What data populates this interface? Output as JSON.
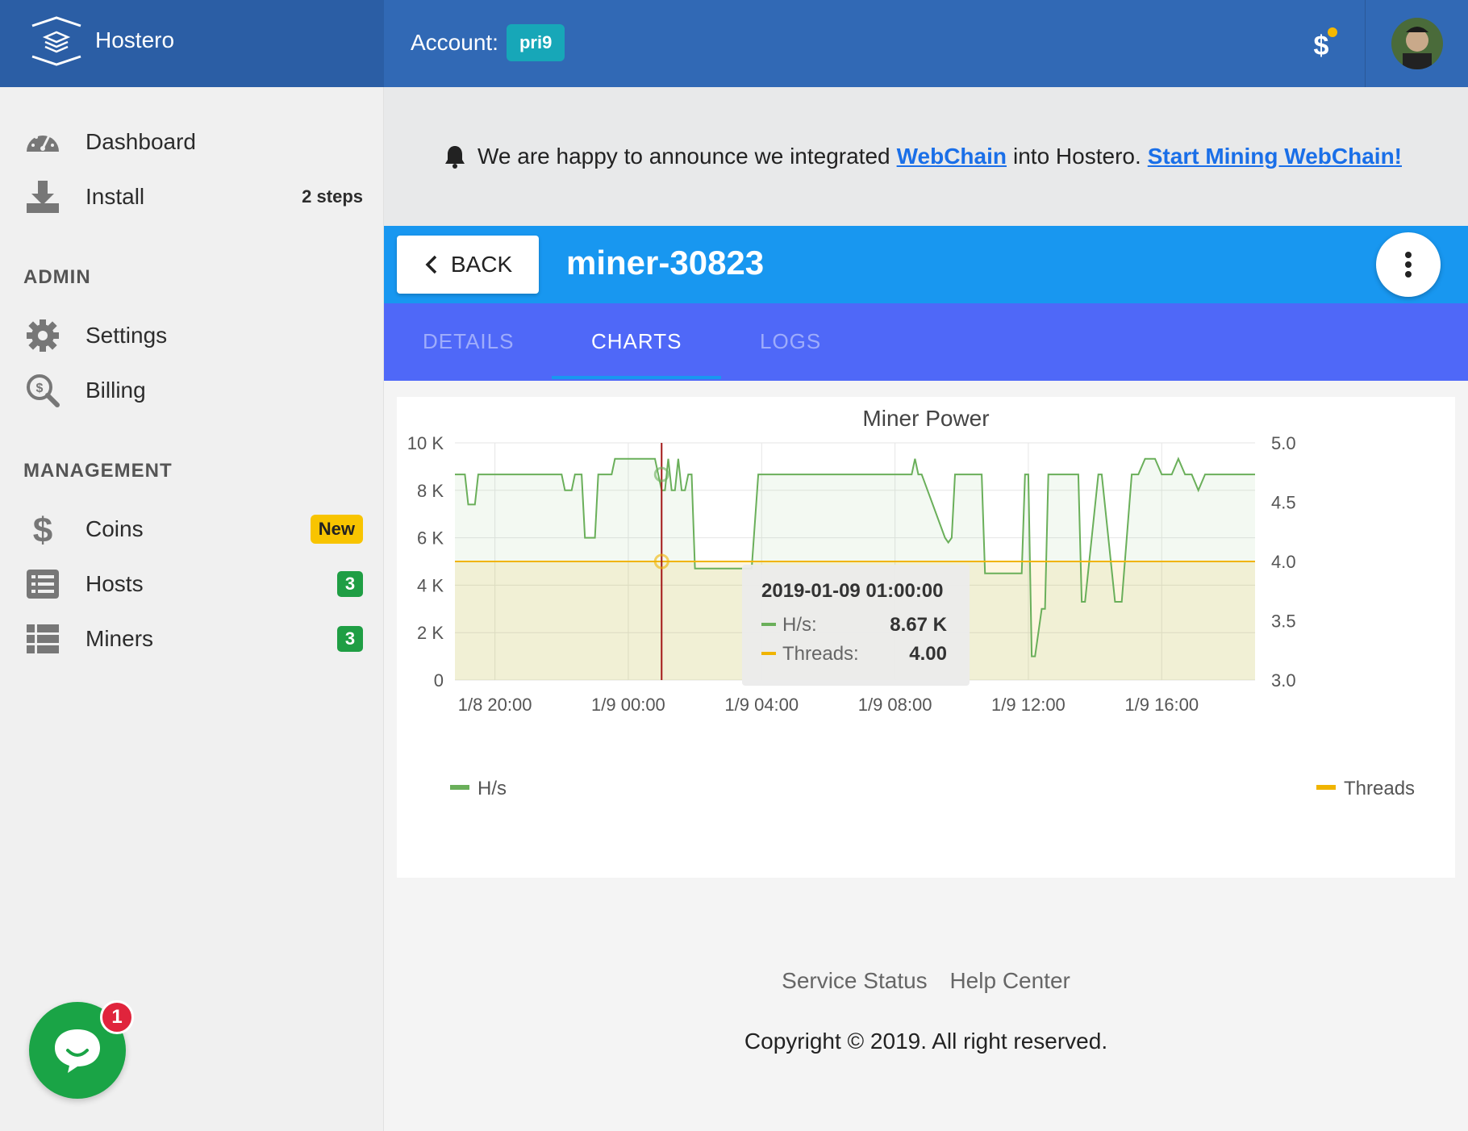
{
  "brand": {
    "name": "Hostero"
  },
  "header": {
    "account_label": "Account:",
    "account_value": "pri9"
  },
  "sidebar": {
    "items_top": [
      {
        "label": "Dashboard",
        "icon": "dashboard-icon"
      },
      {
        "label": "Install",
        "icon": "download-icon",
        "extra": "2 steps"
      }
    ],
    "admin_title": "ADMIN",
    "admin_items": [
      {
        "label": "Settings",
        "icon": "gear-icon"
      },
      {
        "label": "Billing",
        "icon": "billing-search-icon"
      }
    ],
    "management_title": "MANAGEMENT",
    "management_items": [
      {
        "label": "Coins",
        "icon": "dollar-icon",
        "badge": "New"
      },
      {
        "label": "Hosts",
        "icon": "list-icon",
        "badge": "3"
      },
      {
        "label": "Miners",
        "icon": "table-icon",
        "badge": "3"
      }
    ]
  },
  "chat": {
    "unread": "1"
  },
  "announcement": {
    "text_before": "We are happy to announce we integrated",
    "link1": "WebChain",
    "text_middle": "into Hostero.",
    "link2": "Start Mining WebChain!"
  },
  "miner": {
    "back_label": "BACK",
    "title": "miner-30823"
  },
  "tabs": [
    {
      "label": "DETAILS",
      "active": false
    },
    {
      "label": "CHARTS",
      "active": true
    },
    {
      "label": "LOGS",
      "active": false
    }
  ],
  "chart_data": {
    "type": "line",
    "title": "Miner Power",
    "x_ticks": [
      "1/8 20:00",
      "1/9 00:00",
      "1/9 04:00",
      "1/9 08:00",
      "1/9 12:00",
      "1/9 16:00"
    ],
    "y_left_ticks": [
      "10 K",
      "8 K",
      "6 K",
      "4 K",
      "2 K",
      "0"
    ],
    "y_right_ticks": [
      "5.0",
      "4.5",
      "4.0",
      "3.5",
      "3.0"
    ],
    "y_left_range": [
      0,
      10000
    ],
    "y_right_range": [
      3.0,
      5.0
    ],
    "x_range_hours": [
      -5.2,
      18.8
    ],
    "grid": true,
    "legend_position": "bottom",
    "series": [
      {
        "name": "H/s",
        "axis": "left",
        "color": "#6aaf5a",
        "x": [
          -5.2,
          -4.9,
          -4.8,
          -4.6,
          -4.5,
          -2.0,
          -1.9,
          -1.7,
          -1.6,
          -1.4,
          -1.3,
          -1.0,
          -0.9,
          -0.5,
          -0.4,
          0.8,
          1.0,
          1.1,
          1.2,
          1.3,
          1.4,
          1.5,
          1.6,
          1.7,
          1.8,
          1.9,
          2.0,
          3.7,
          3.9,
          8.5,
          8.6,
          8.7,
          8.8,
          9.5,
          9.6,
          9.7,
          9.8,
          10.6,
          10.7,
          11.8,
          11.9,
          12.0,
          12.1,
          12.2,
          12.4,
          12.5,
          12.6,
          13.5,
          13.6,
          13.7,
          14.1,
          14.2,
          14.6,
          14.8,
          15.1,
          15.3,
          15.5,
          15.8,
          16.0,
          16.3,
          16.5,
          16.7,
          16.9,
          17.1,
          17.3,
          18.8
        ],
        "values": [
          8670,
          8670,
          7400,
          7400,
          8670,
          8670,
          8000,
          8000,
          8670,
          8670,
          6000,
          6000,
          8670,
          8670,
          9330,
          9330,
          8000,
          8000,
          9330,
          8000,
          8000,
          9330,
          8000,
          8000,
          8670,
          8670,
          4700,
          4700,
          8670,
          8670,
          9330,
          8670,
          8670,
          6000,
          5800,
          6000,
          8670,
          8670,
          4500,
          4500,
          8670,
          8670,
          1000,
          1000,
          3000,
          3000,
          8670,
          8670,
          3300,
          3300,
          8670,
          8670,
          3300,
          3300,
          8670,
          8670,
          9330,
          9330,
          8670,
          8670,
          9330,
          8670,
          8670,
          8000,
          8670,
          8670
        ]
      },
      {
        "name": "Threads",
        "axis": "right",
        "color": "#f0b400",
        "x": [
          -5.2,
          18.8
        ],
        "values": [
          4.0,
          4.0
        ]
      }
    ],
    "tooltip": {
      "time": "2019-01-09 01:00:00",
      "rows": [
        {
          "label": "H/s:",
          "value": "8.67 K"
        },
        {
          "label": "Threads:",
          "value": "4.00"
        }
      ],
      "x": 1.0
    }
  },
  "footer": {
    "links": [
      "Service Status",
      "Help Center"
    ],
    "copyright": "Copyright © 2019. All right reserved."
  }
}
